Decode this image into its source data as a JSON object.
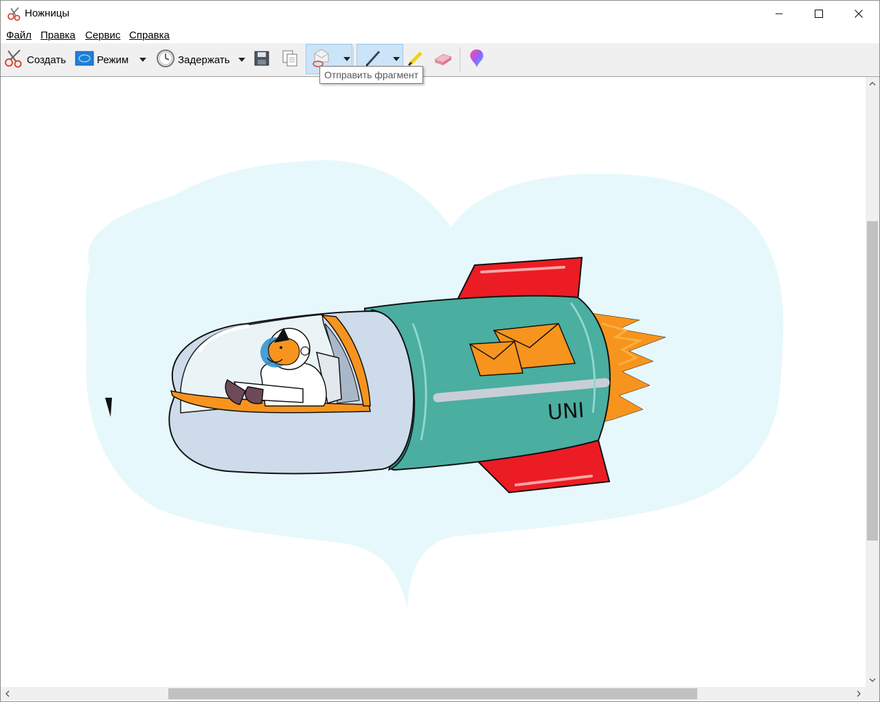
{
  "window": {
    "title": "Ножницы",
    "icon": "scissors-icon"
  },
  "menu": {
    "items": [
      "Файл",
      "Правка",
      "Сервис",
      "Справка"
    ]
  },
  "toolbar": {
    "new_label": "Создать",
    "mode_label": "Режим",
    "delay_label": "Задержать",
    "icons": [
      "scissors-icon",
      "mode-icon",
      "clock-icon",
      "save-icon",
      "copy-icon",
      "send-icon",
      "pen-icon",
      "highlighter-icon",
      "eraser-icon",
      "paint3d-icon"
    ],
    "pen_selected": true
  },
  "tooltip": {
    "text": "Отправить фрагмент"
  },
  "image": {
    "rocket_text": "UNI",
    "colors": {
      "background_cloud": "#e6f8fb",
      "rocket_body": "#4aaea0",
      "fins": "#ec1c24",
      "flame": "#f7941d",
      "envelope": "#f7941d",
      "cockpit": "#cddbea"
    }
  }
}
